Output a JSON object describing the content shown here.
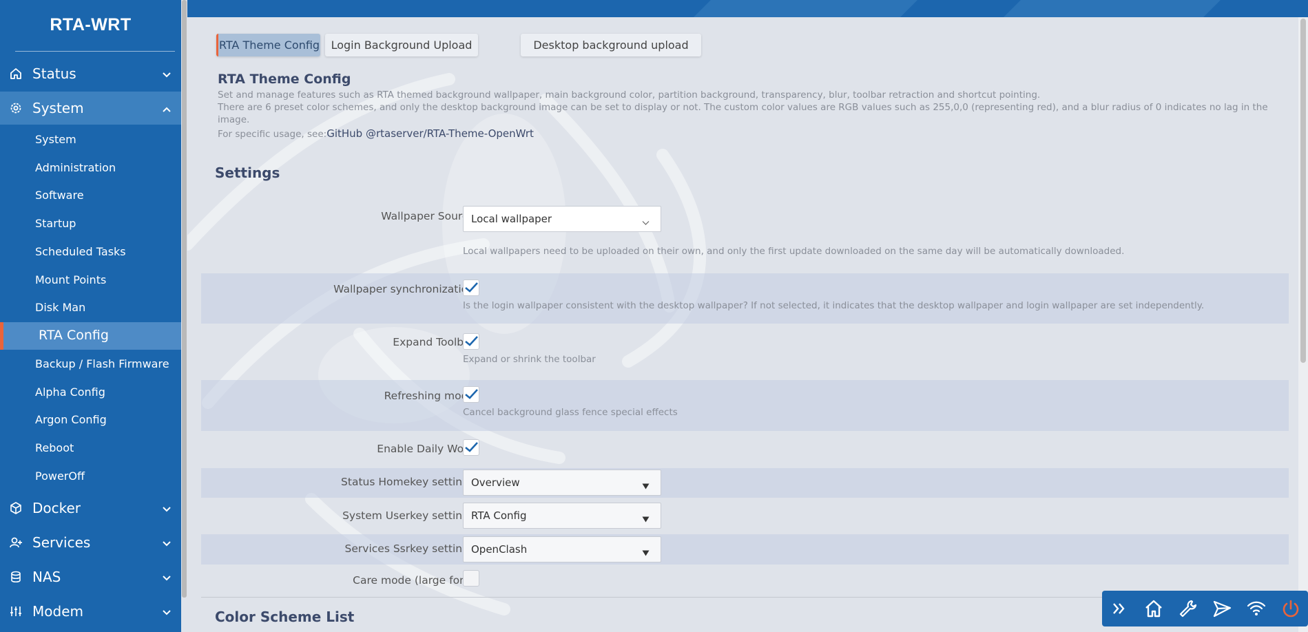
{
  "brand": "RTA-WRT",
  "sidebar": {
    "menus": [
      {
        "label": "Status",
        "icon": "home-icon"
      },
      {
        "label": "System",
        "icon": "gear-icon"
      },
      {
        "label": "Docker",
        "icon": "cube-icon"
      },
      {
        "label": "Services",
        "icon": "user-plus-icon"
      },
      {
        "label": "NAS",
        "icon": "database-icon"
      },
      {
        "label": "Modem",
        "icon": "sliders-icon"
      }
    ],
    "system_items": [
      "System",
      "Administration",
      "Software",
      "Startup",
      "Scheduled Tasks",
      "Mount Points",
      "Disk Man",
      "RTA Config",
      "Backup / Flash Firmware",
      "Alpha Config",
      "Argon Config",
      "Reboot",
      "PowerOff"
    ]
  },
  "tabs": [
    "RTA Theme Config",
    "Login Background Upload",
    "Desktop background upload"
  ],
  "section": {
    "title": "RTA Theme Config",
    "desc1": "Set and manage features such as RTA themed background wallpaper, main background color, partition background, transparency, blur, toolbar retraction and shortcut pointing.",
    "desc2": "There are 6 preset color schemes, and only the desktop background image can be set to display or not. The custom color values are RGB values such as 255,0,0 (representing red), and a blur radius of 0 indicates no lag in the image.",
    "usage_prefix": "For specific usage, see:",
    "usage_link": "GitHub @rtaserver/RTA-Theme-OpenWrt"
  },
  "settings": {
    "heading": "Settings",
    "wallpaper_source": {
      "label": "Wallpaper Source",
      "value": "Local wallpaper",
      "help": "Local wallpapers need to be uploaded on their own, and only the first update downloaded on the same day will be automatically downloaded."
    },
    "wallpaper_sync": {
      "label": "Wallpaper synchronization",
      "checked": true,
      "help": "Is the login wallpaper consistent with the desktop wallpaper? If not selected, it indicates that the desktop wallpaper and login wallpaper are set independently."
    },
    "expand_toolbar": {
      "label": "Expand Toolbar",
      "checked": true,
      "help": "Expand or shrink the toolbar"
    },
    "refreshing_mode": {
      "label": "Refreshing mode",
      "checked": true,
      "help": "Cancel background glass fence special effects"
    },
    "daily_word": {
      "label": "Enable Daily Word",
      "checked": true
    },
    "status_homekey": {
      "label": "Status Homekey settings",
      "value": "Overview"
    },
    "system_userkey": {
      "label": "System Userkey settings",
      "value": "RTA Config"
    },
    "services_ssrkey": {
      "label": "Services Ssrkey settings",
      "value": "OpenClash"
    },
    "care_mode": {
      "label": "Care mode (large font)",
      "checked": false
    }
  },
  "color_scheme_heading": "Color Scheme List",
  "toolbar": [
    "expand-icon",
    "home-icon",
    "wrench-icon",
    "send-icon",
    "wifi-icon",
    "power-icon"
  ],
  "colors": {
    "sidebar": "#1b66ad",
    "accent": "#e9643b",
    "active_menu": "#3d81bf"
  }
}
